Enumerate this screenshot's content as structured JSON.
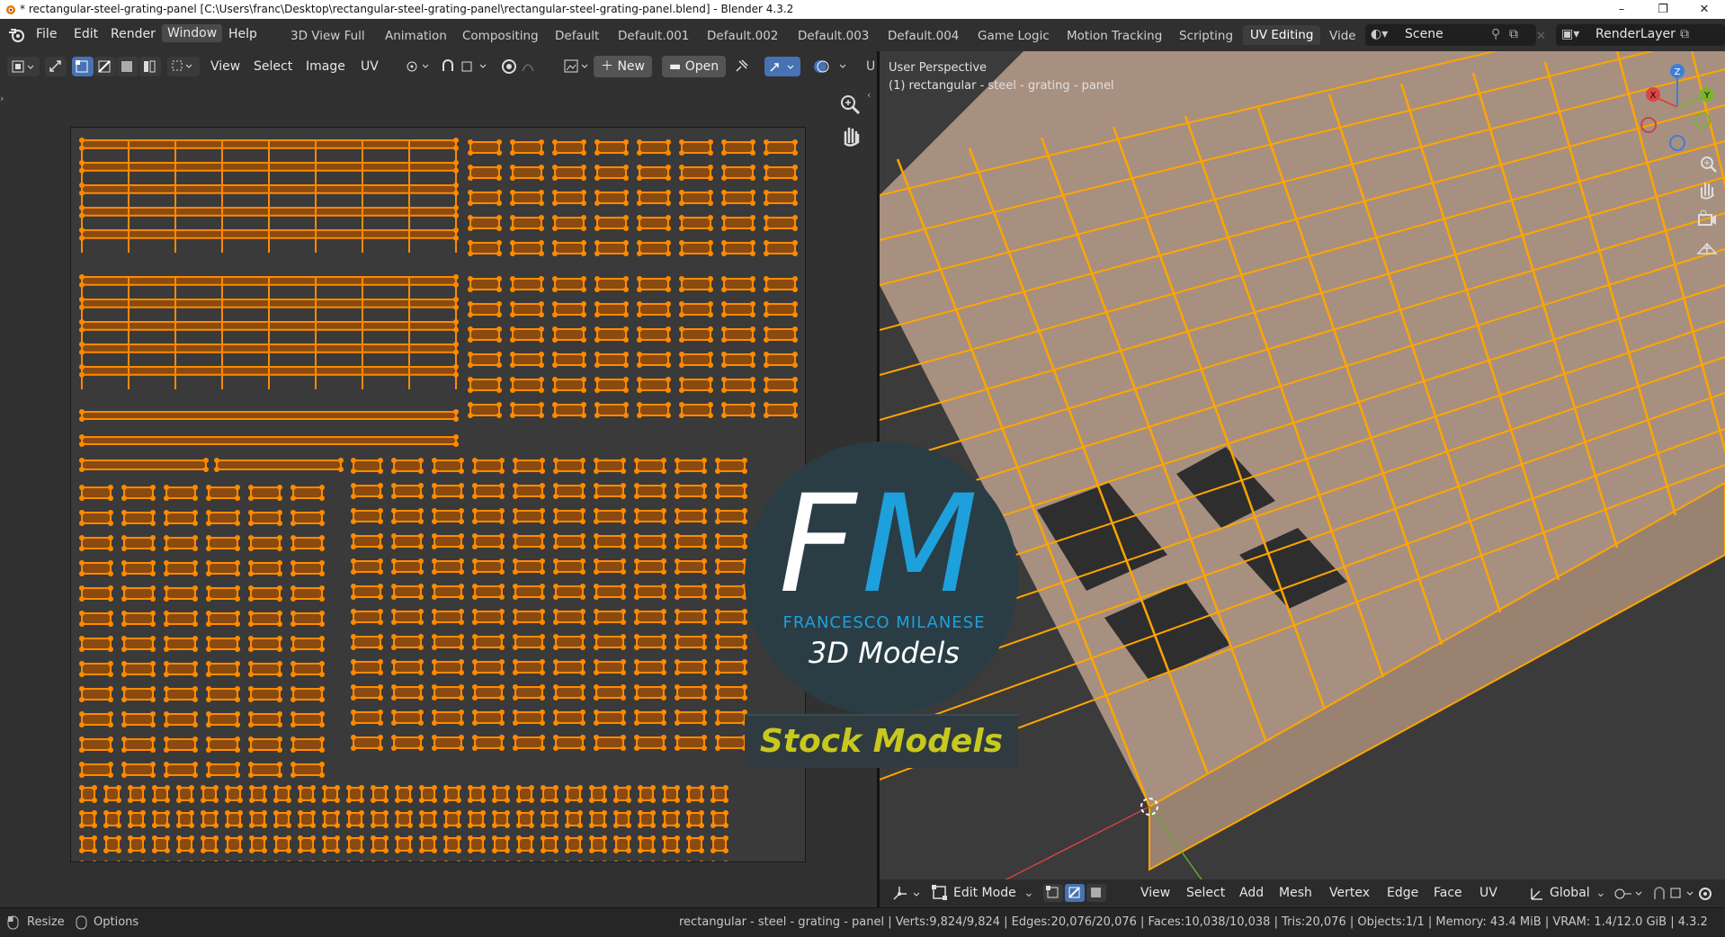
{
  "window": {
    "title": "* rectangular-steel-grating-panel [C:\\Users\\franc\\Desktop\\rectangular-steel-grating-panel\\rectangular-steel-grating-panel.blend] - Blender 4.3.2",
    "minimize": "–",
    "restore": "❐",
    "close": "✕"
  },
  "menu": {
    "file": "File",
    "edit": "Edit",
    "render": "Render",
    "window": "Window",
    "help": "Help"
  },
  "workspaces": [
    "3D View Full",
    "Animation",
    "Compositing",
    "Default",
    "Default.001",
    "Default.002",
    "Default.003",
    "Default.004",
    "Game Logic",
    "Motion Tracking",
    "Scripting",
    "UV Editing",
    "Vide"
  ],
  "active_workspace": "UV Editing",
  "scene_field": "Scene",
  "layer_field": "RenderLayer",
  "uv_header": {
    "view": "View",
    "select": "Select",
    "image": "Image",
    "uv": "UV",
    "new_button": "New",
    "open_button": "Open",
    "cut_label": "U"
  },
  "viewport": {
    "perspective": "User Perspective",
    "object_label": "(1) rectangular - steel - grating - panel",
    "gizmo": {
      "x": "X",
      "y": "Y",
      "z": "Z"
    },
    "mode": "Edit Mode",
    "menus": [
      "View",
      "Select",
      "Add",
      "Mesh",
      "Vertex",
      "Edge",
      "Face",
      "UV"
    ],
    "orientation": "Global"
  },
  "watermark": {
    "letters_f": "F",
    "letters_m": "M",
    "name": "FRANCESCO MILANESE",
    "sub": "3D Models",
    "banner": "Stock Models",
    "colors": {
      "circle": "#2a3d45",
      "f": "#ffffff",
      "m": "#1ea0dc",
      "banner_text": "#c8c81e"
    }
  },
  "status": {
    "resize": "Resize",
    "options": "Options",
    "stats": "rectangular - steel - grating - panel | Verts:9,824/9,824 | Edges:20,076/20,076 | Faces:10,038/10,038 | Tris:20,076 | Objects:1/1 | Memory: 43.4 MiB | VRAM: 1.4/12.0 GiB | 4.3.2"
  },
  "colors": {
    "accent": "#4772b3",
    "uv_selected": "#ff8a00",
    "mesh_edge": "#ffa500"
  }
}
